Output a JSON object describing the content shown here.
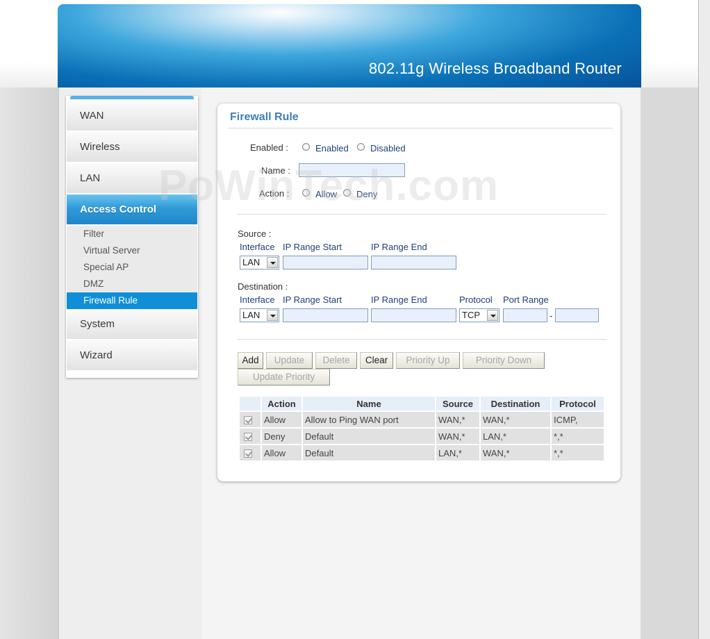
{
  "header": {
    "title": "802.11g Wireless Broadband Router"
  },
  "sidebar": {
    "items": [
      {
        "label": "WAN"
      },
      {
        "label": "Wireless"
      },
      {
        "label": "LAN"
      },
      {
        "label": "Access Control"
      },
      {
        "label": "System"
      },
      {
        "label": "Wizard"
      }
    ],
    "submenu": [
      {
        "label": "Filter"
      },
      {
        "label": "Virtual Server"
      },
      {
        "label": "Special AP"
      },
      {
        "label": "DMZ"
      },
      {
        "label": "Firewall Rule"
      }
    ],
    "active_item": "Access Control",
    "selected_subitem": "Firewall Rule"
  },
  "panel": {
    "title": "Firewall Rule",
    "enabled_label": "Enabled :",
    "enabled_option": "Enabled",
    "disabled_option": "Disabled",
    "name_label": "Name :",
    "name_value": "",
    "action_label": "Action :",
    "allow_option": "Allow",
    "deny_option": "Deny"
  },
  "source": {
    "label": "Source :",
    "interface_header": "Interface",
    "ip_start_header": "IP Range Start",
    "ip_end_header": "IP Range End",
    "interface_value": "LAN",
    "ip_start_value": "",
    "ip_end_value": ""
  },
  "destination": {
    "label": "Destination :",
    "interface_header": "Interface",
    "ip_start_header": "IP Range Start",
    "ip_end_header": "IP Range End",
    "protocol_header": "Protocol",
    "port_range_header": "Port Range",
    "interface_value": "LAN",
    "protocol_value": "TCP",
    "port_separator": "-",
    "ip_start_value": "",
    "ip_end_value": "",
    "port_start_value": "",
    "port_end_value": ""
  },
  "buttons": {
    "add": "Add",
    "update": "Update",
    "delete": "Delete",
    "clear": "Clear",
    "priority_up": "Priority Up",
    "priority_down": "Priority Down",
    "update_priority": "Update Priority"
  },
  "table": {
    "headers": [
      "Action",
      "Name",
      "Source",
      "Destination",
      "Protocol"
    ],
    "rows": [
      {
        "checked": true,
        "action": "Allow",
        "name": "Allow to Ping WAN port",
        "source": "WAN,*",
        "destination": "WAN,*",
        "protocol": "ICMP,"
      },
      {
        "checked": true,
        "action": "Deny",
        "name": "Default",
        "source": "WAN,*",
        "destination": "LAN,*",
        "protocol": "*,*"
      },
      {
        "checked": true,
        "action": "Allow",
        "name": "Default",
        "source": "LAN,*",
        "destination": "WAN,*",
        "protocol": "*,*"
      }
    ]
  },
  "watermark": "PoWinTech.com",
  "colors": {
    "accent_blue": "#0e8fd8",
    "title_blue": "#3d7fbd",
    "header_dark": "#08539a"
  }
}
